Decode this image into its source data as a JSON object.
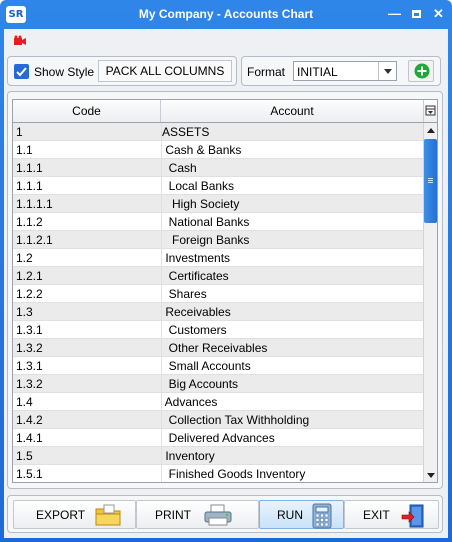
{
  "window": {
    "title": "My Company - Accounts Chart",
    "logo": "SR",
    "controls": [
      "minimize-icon",
      "maximize-icon",
      "close-icon"
    ]
  },
  "toolbar": {
    "camera_icon": "camera-icon"
  },
  "options": {
    "show_style_label": "Show Style",
    "show_style_checked": true,
    "pack_label": "PACK ALL COLUMNS"
  },
  "format": {
    "label": "Format",
    "value": "INITIAL",
    "add_icon": "add-icon"
  },
  "grid": {
    "columns": [
      "Code",
      "Account"
    ],
    "rows": [
      {
        "code": "1",
        "account": "ASSETS"
      },
      {
        "code": "1.1",
        "account": " Cash & Banks"
      },
      {
        "code": "1.1.1",
        "account": "  Cash"
      },
      {
        "code": "1.1.1",
        "account": "  Local Banks"
      },
      {
        "code": "1.1.1.1",
        "account": "   High Society"
      },
      {
        "code": "1.1.2",
        "account": "  National Banks"
      },
      {
        "code": "1.1.2.1",
        "account": "   Foreign Banks"
      },
      {
        "code": "1.2",
        "account": " Investments"
      },
      {
        "code": "1.2.1",
        "account": "  Certificates"
      },
      {
        "code": "1.2.2",
        "account": "  Shares"
      },
      {
        "code": "1.3",
        "account": " Receivables"
      },
      {
        "code": "1.3.1",
        "account": "  Customers"
      },
      {
        "code": "1.3.2",
        "account": "  Other Receivables"
      },
      {
        "code": "1.3.1",
        "account": "  Small Accounts"
      },
      {
        "code": "1.3.2",
        "account": "  Big Accounts"
      },
      {
        "code": "1.4",
        "account": " Advances"
      },
      {
        "code": "1.4.2",
        "account": "  Collection Tax Withholding"
      },
      {
        "code": "1.4.1",
        "account": "  Delivered Advances"
      },
      {
        "code": "1.5",
        "account": " Inventory"
      },
      {
        "code": "1.5.1",
        "account": "  Finished Goods Inventory"
      }
    ]
  },
  "actions": {
    "export": "EXPORT",
    "print": "PRINT",
    "run": "RUN",
    "exit": "EXIT"
  },
  "colors": {
    "titlebar": "#1d6ad6",
    "accent": "#2769d7",
    "alt_row": "#ebebeb"
  }
}
